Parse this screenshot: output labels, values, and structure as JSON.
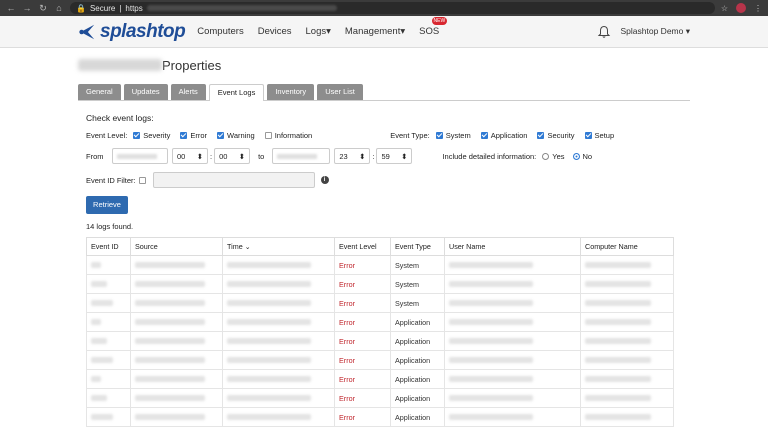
{
  "browser": {
    "secure_label": "Secure",
    "url_prefix": "https"
  },
  "header": {
    "nav": [
      "Computers",
      "Devices",
      "Logs",
      "Management",
      "SOS"
    ],
    "sos_badge": "NEW",
    "user": "Splashtop Demo",
    "logo_text": "splashtop"
  },
  "page": {
    "title": "Properties"
  },
  "tabs": [
    "General",
    "Updates",
    "Alerts",
    "Event Logs",
    "Inventory",
    "User List"
  ],
  "filters": {
    "heading": "Check event logs:",
    "event_level_label": "Event Level:",
    "levels": [
      "Severity",
      "Error",
      "Warning",
      "Information"
    ],
    "event_type_label": "Event Type:",
    "types": [
      "System",
      "Application",
      "Security",
      "Setup"
    ],
    "from_label": "From",
    "to_label": "to",
    "from_hour": "00",
    "from_min": "00",
    "to_hour": "23",
    "to_min": "59",
    "detail_label": "Include detailed information:",
    "yes": "Yes",
    "no": "No",
    "event_id_label": "Event ID Filter:",
    "retrieve": "Retrieve",
    "found": "14 logs found."
  },
  "table": {
    "headers": [
      "Event ID",
      "Source",
      "Time",
      "Event Level",
      "Event Type",
      "User Name",
      "Computer Name"
    ],
    "rows": [
      {
        "level": "Error",
        "type": "System"
      },
      {
        "level": "Error",
        "type": "System"
      },
      {
        "level": "Error",
        "type": "System"
      },
      {
        "level": "Error",
        "type": "Application"
      },
      {
        "level": "Error",
        "type": "Application"
      },
      {
        "level": "Error",
        "type": "Application"
      },
      {
        "level": "Error",
        "type": "Application"
      },
      {
        "level": "Error",
        "type": "Application"
      },
      {
        "level": "Error",
        "type": "Application"
      }
    ]
  },
  "colors": {
    "brand": "#1f4d97",
    "accent": "#2f7ad4",
    "error": "#c0262d"
  }
}
